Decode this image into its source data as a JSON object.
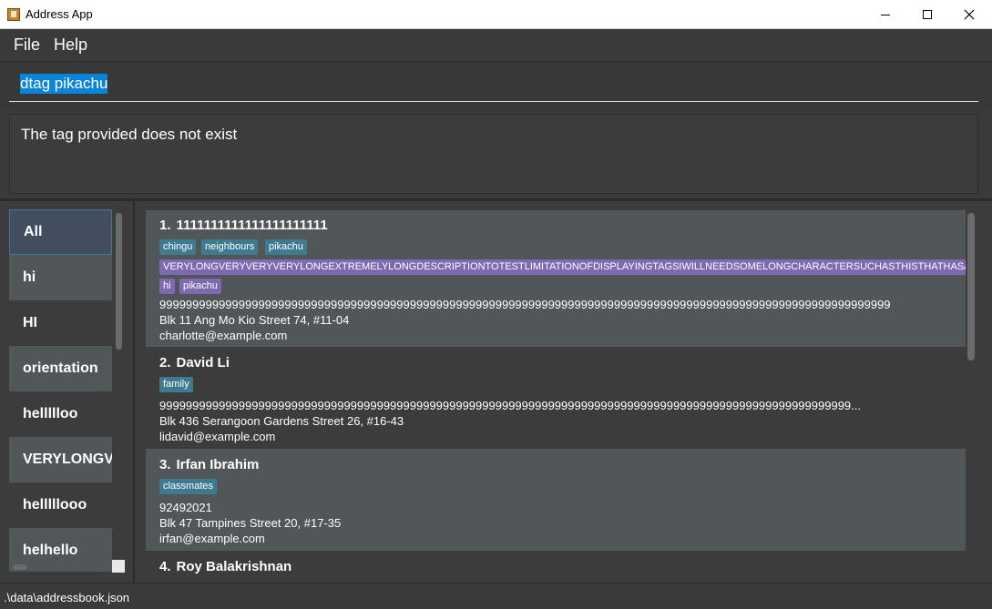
{
  "window": {
    "title": "Address App"
  },
  "menu": {
    "file_label": "File",
    "help_label": "Help"
  },
  "command": {
    "value": "dtag pikachu"
  },
  "result": {
    "message": "The tag provided does not exist"
  },
  "tags": [
    {
      "label": "All"
    },
    {
      "label": "hi"
    },
    {
      "label": "HI"
    },
    {
      "label": "orientation"
    },
    {
      "label": "hellllloo"
    },
    {
      "label": "VERYLONGVERYVERYVERYLONGEXTREMELYLONGDESCRIPTIONTOTESTLIMITATIONOFDISPLAYINGTAGSIWILLNEEDSOMELONGCHARACTERSUCHASTHISTHATHASALOTOFWORDS"
    },
    {
      "label": "helllllooo"
    },
    {
      "label": "helhello"
    }
  ],
  "persons": [
    {
      "index": "1.",
      "name": "1111111111111111111111",
      "tags_row1": [
        "chingu",
        "neighbours",
        "pikachu"
      ],
      "long_tag": "VERYLONGVERYVERYVERYLONGEXTREMELYLONGDESCRIPTIONTOTESTLIMITATIONOFDISPLAYINGTAGSIWILLNEEDSOMELONGCHARACTERSUCHASTHISTHATHASALOTOFWORDS",
      "tags_row3": [
        "hi",
        "pikachu"
      ],
      "phone": "999999999999999999999999999999999999999999999999999999999999999999999999999999999999999999999999999999999999999",
      "address": "Blk 11 Ang Mo Kio Street 74, #11-04",
      "email": "charlotte@example.com"
    },
    {
      "index": "2.",
      "name": "David Li",
      "tags": [
        "family"
      ],
      "phone": "999999999999999999999999999999999999999999999999999999999999999999999999999999999999999999999999999999999...",
      "address": "Blk 436 Serangoon Gardens Street 26, #16-43",
      "email": "lidavid@example.com"
    },
    {
      "index": "3.",
      "name": "Irfan Ibrahim",
      "tags": [
        "classmates"
      ],
      "phone": "92492021",
      "address": "Blk 47 Tampines Street 20, #17-35",
      "email": "irfan@example.com"
    },
    {
      "index": "4.",
      "name": "Roy Balakrishnan"
    }
  ],
  "status": {
    "path": ".\\data\\addressbook.json"
  },
  "colors": {
    "background": "#3c3c3c",
    "tag_blue": "#3e7b91",
    "tag_purple": "#7e69b3",
    "selection": "#0a84d6"
  }
}
